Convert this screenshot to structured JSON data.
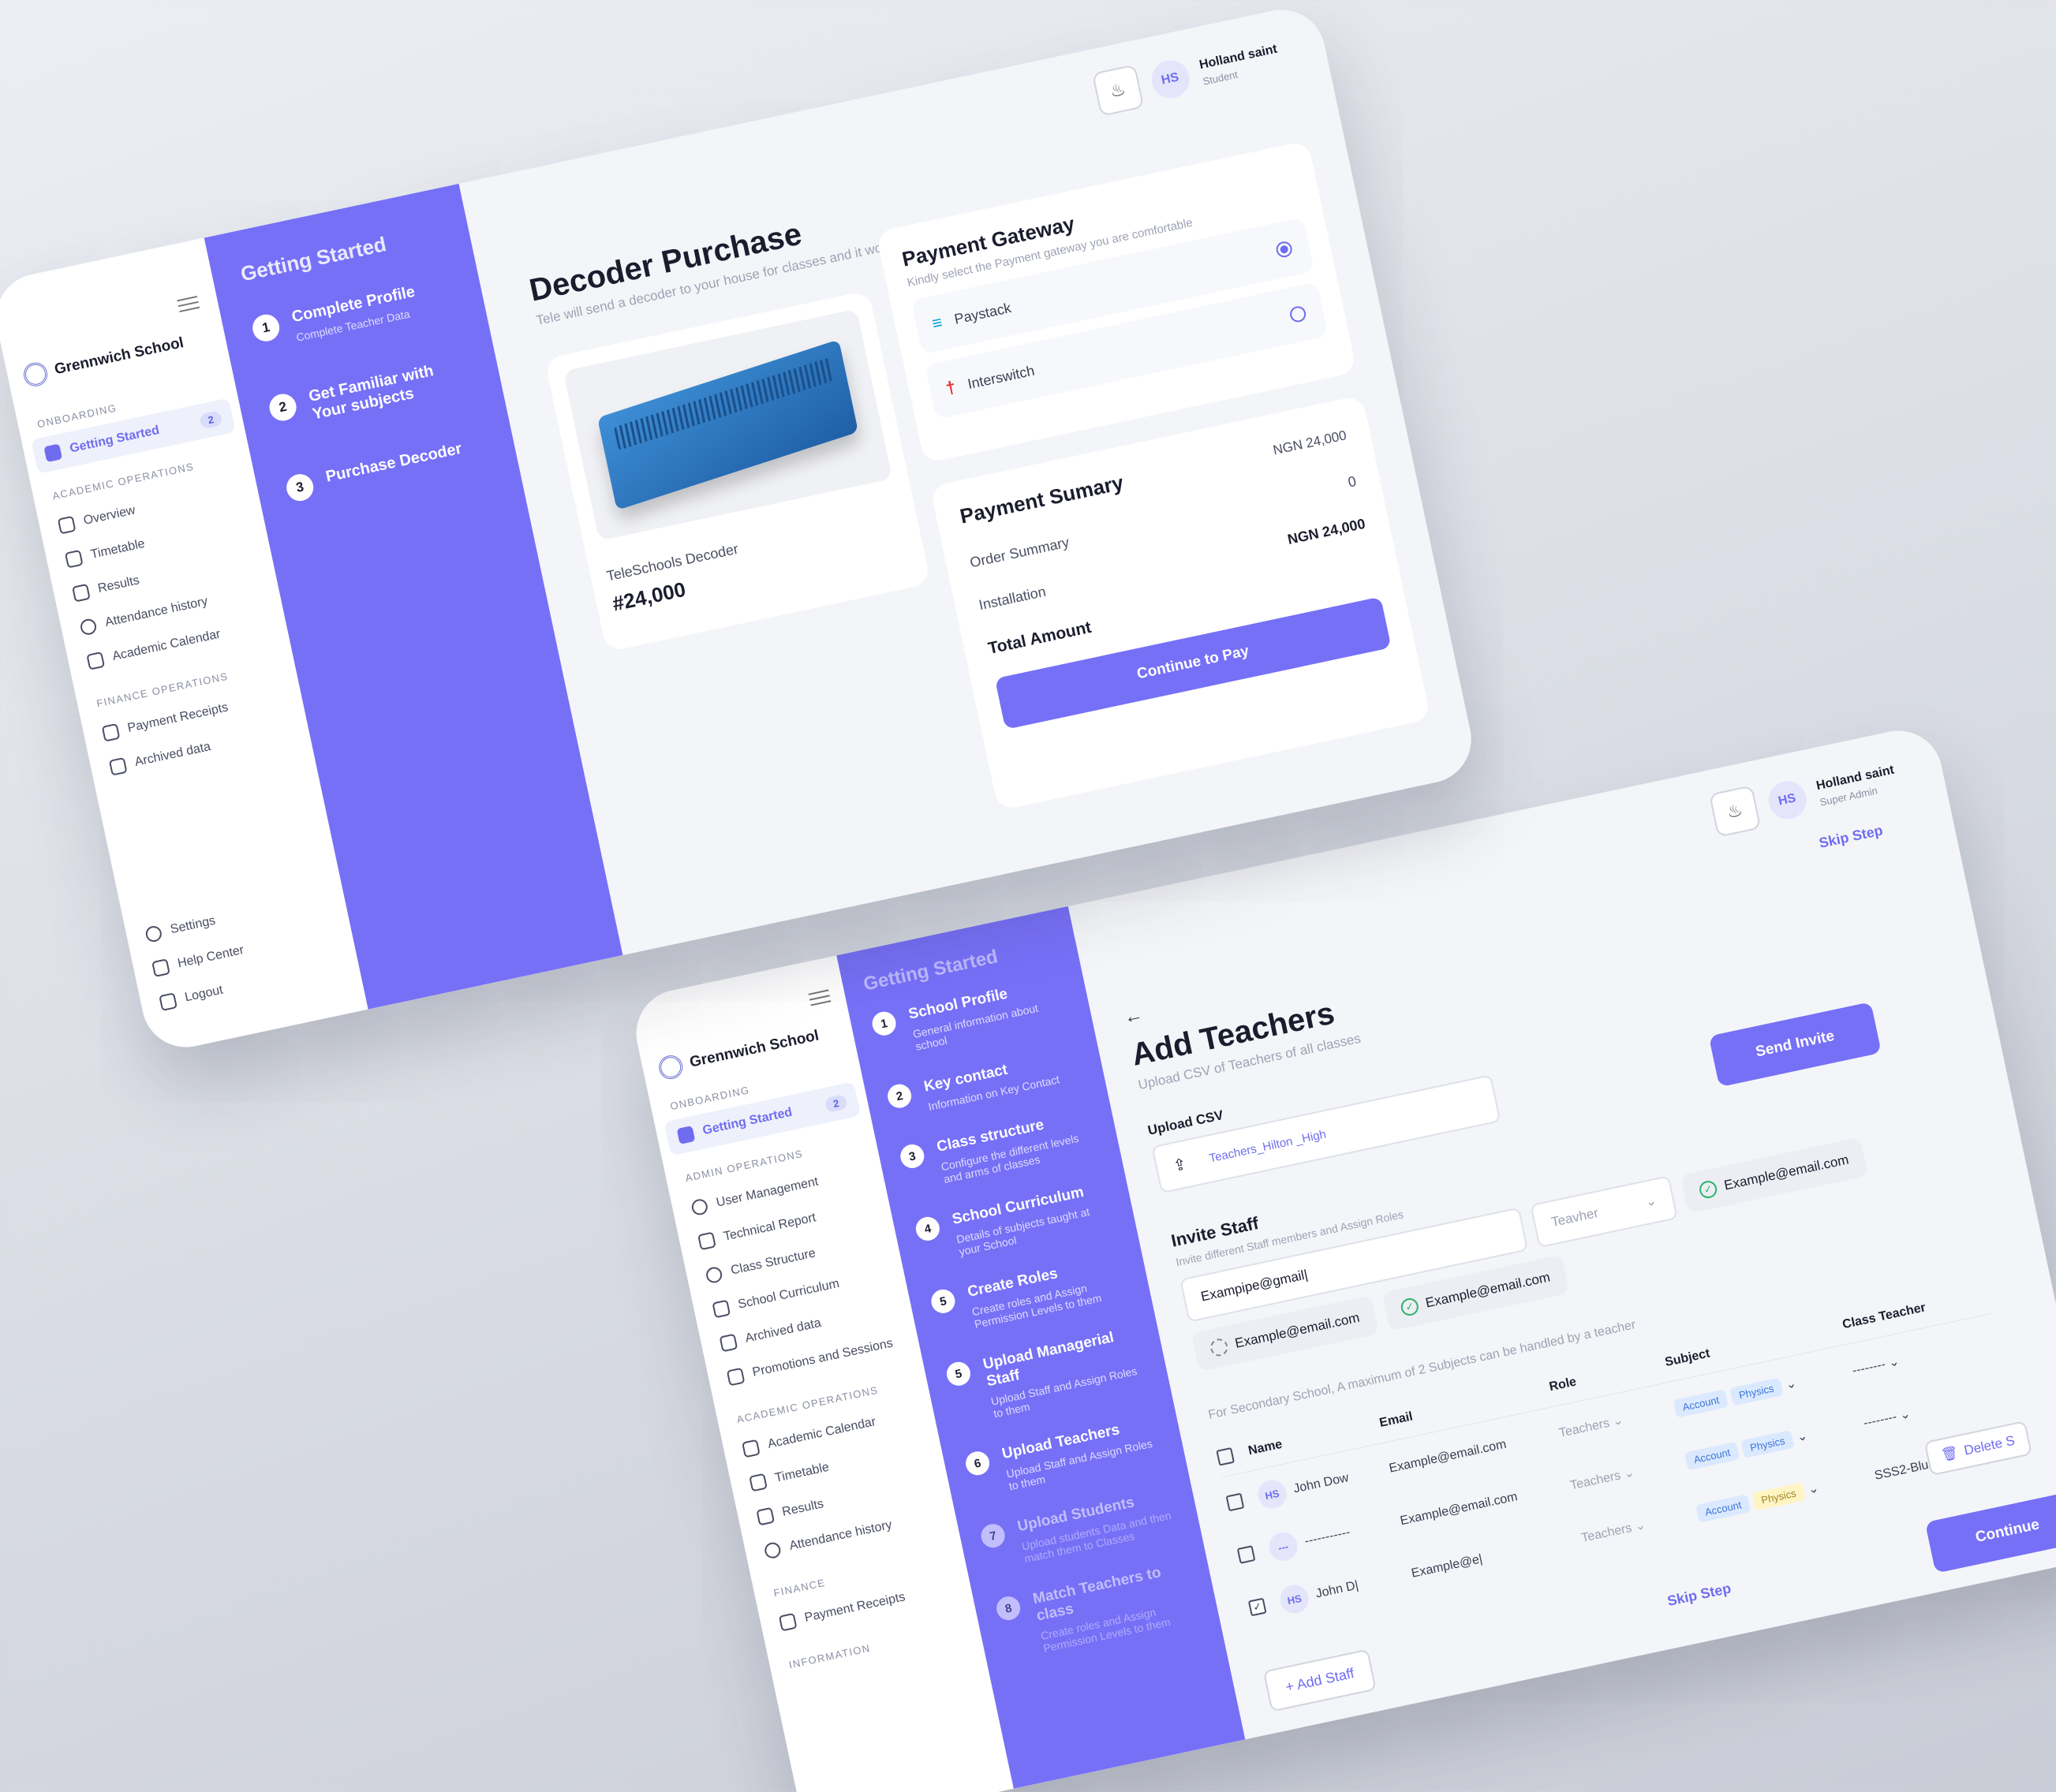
{
  "screen1": {
    "school_name": "Grennwich School",
    "onboarding_label": "ONBOARDING",
    "getting_started": "Getting Started",
    "getting_started_badge": "2",
    "academic_label": "ACADEMIC OPERATIONS",
    "academic_items": [
      "Overview",
      "Timetable",
      "Results",
      "Attendance history",
      "Academic Calendar"
    ],
    "finance_label": "FINANCE OPERATIONS",
    "finance_items": [
      "Payment Receipts",
      "Archived data"
    ],
    "bottom_items": [
      "Settings",
      "Help Center",
      "Logout"
    ],
    "steps_title": "Getting Started",
    "steps": [
      {
        "num": "1",
        "title": "Complete Profile",
        "sub": "Complete Teacher Data"
      },
      {
        "num": "2",
        "title": "Get Familiar with Your subjects",
        "sub": ""
      },
      {
        "num": "3",
        "title": "Purchase Decoder",
        "sub": ""
      }
    ],
    "user": {
      "initials": "HS",
      "name": "Holland saint",
      "role": "Student"
    },
    "title": "Decoder Purchase",
    "subtitle": "Tele will send a decoder to your house for classes and it would be installed for you.",
    "product": {
      "name": "TeleSchools  Decoder",
      "price": "#24,000"
    },
    "gateway": {
      "title": "Payment Gateway",
      "subtitle": "Kindly select the Payment gateway you are comfortable",
      "options": [
        "Paystack",
        "Interswitch"
      ]
    },
    "summary": {
      "title": "Payment Sumary",
      "title_value": "NGN 24,000",
      "rows": [
        {
          "label": "Order Summary",
          "value": "0"
        },
        {
          "label": "Installation",
          "value": "NGN 24,000"
        }
      ],
      "total_label": "Total Amount",
      "button": "Continue to Pay"
    }
  },
  "screen2": {
    "school_name": "Grennwich School",
    "onboarding_label": "ONBOARDING",
    "getting_started": "Getting Started",
    "getting_started_badge": "2",
    "admin_label": "ADMIN OPERATIONS",
    "admin_items": [
      "User Management",
      "Technical Report",
      "Class Structure",
      "School Curriculum",
      "Archived data",
      "Promotions and Sessions"
    ],
    "academic_label": "ACADEMIC OPERATIONS",
    "academic_items": [
      "Academic Calendar",
      "Timetable",
      "Results",
      "Attendance history"
    ],
    "finance_label": "FINANCE",
    "finance_items": [
      "Payment Receipts"
    ],
    "more_label": "INFORMATION",
    "steps_title": "Getting Started",
    "steps": [
      {
        "num": "1",
        "title": "School Profile",
        "sub": "General information about school"
      },
      {
        "num": "2",
        "title": "Key contact",
        "sub": "Information on Key Contact"
      },
      {
        "num": "3",
        "title": "Class structure",
        "sub": "Configure the different levels and arms of classes"
      },
      {
        "num": "4",
        "title": "School Curriculum",
        "sub": "Details of subjects  taught at your School"
      },
      {
        "num": "5",
        "title": "Create Roles",
        "sub": "Create roles and Assign Permission Levels to them"
      },
      {
        "num": "5",
        "title": "Upload Managerial  Staff",
        "sub": "Upload Staff and Assign Roles to them"
      },
      {
        "num": "6",
        "title": "Upload Teachers",
        "sub": "Upload Staff and Assign Roles to them"
      },
      {
        "num": "7",
        "title": "Upload Students",
        "sub": "Upload students Data and then match them to Classes"
      },
      {
        "num": "8",
        "title": "Match Teachers to class",
        "sub": "Create roles and Assign Permission Levels to them"
      }
    ],
    "user": {
      "initials": "HS",
      "name": "Holland saint",
      "role": "Super Admin"
    },
    "skip_top": "Skip Step",
    "title": "Add Teachers",
    "subtitle": "Upload CSV of Teachers of all classes",
    "upload_label": "Upload CSV",
    "upload_file": "Teachers_Hilton _High",
    "send_invite": "Send Invite",
    "invite_title": "Invite Staff",
    "invite_sub": "Invite different Staff members  and Assign Roles",
    "invite_input": "Exampipe@gmail|",
    "role_select": "Teavher",
    "chips": [
      {
        "email": "Example@email.com",
        "status": "done"
      },
      {
        "email": "Example@email.com",
        "status": "done"
      },
      {
        "email": "Example@email.com",
        "status": "pending"
      }
    ],
    "note": "For Secondary School, A maximum of 2 Subjects  can be handled by a teacher",
    "table": {
      "headers": [
        "Name",
        "Email",
        "Role",
        "Subject",
        "Class Teacher"
      ],
      "rows": [
        {
          "initials": "HS",
          "name": "John Dow",
          "email": "Example@email.com",
          "role": "Teachers",
          "subjects": [
            "Account",
            "Physics"
          ],
          "class": "--------",
          "checked": false
        },
        {
          "initials": "---",
          "name": "-----------",
          "email": "Example@email.com",
          "role": "Teachers",
          "subjects": [
            "Account",
            "Physics"
          ],
          "class": "--------",
          "checked": false
        },
        {
          "initials": "HS",
          "name": "John D|",
          "email": "Example@e|",
          "role": "Teachers",
          "subjects": [
            "Account",
            "Physics"
          ],
          "class": "SSS2-Blue",
          "checked": true
        }
      ]
    },
    "delete_label": "Delete S",
    "add_staff": "Add Staff",
    "skip_bottom": "Skip Step",
    "continue": "Continue"
  }
}
